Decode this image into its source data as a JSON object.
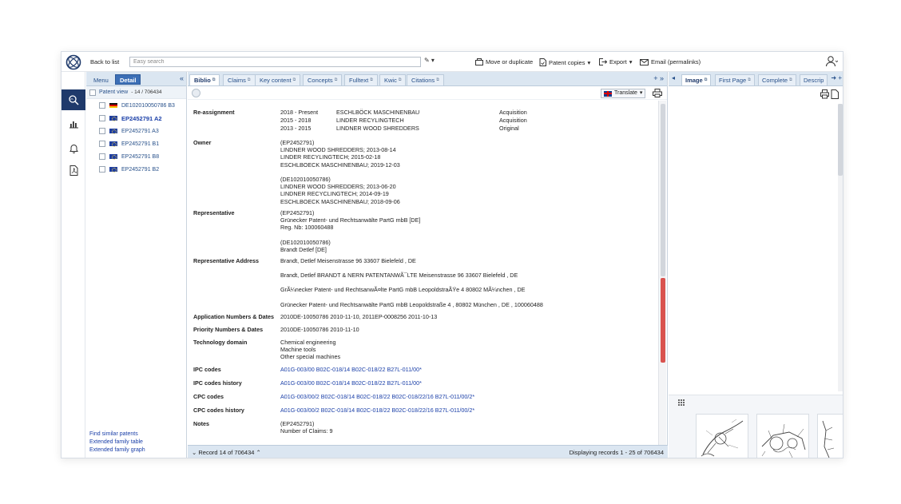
{
  "toolbar": {
    "back_label": "Back to list",
    "search_placeholder": "Easy search",
    "pen_label": "✎ ▾",
    "move_label": "Move or duplicate",
    "copies_label": "Patent copies",
    "export_label": "Export",
    "email_label": "Email (permalinks)"
  },
  "left_panel": {
    "tab_menu": "Menu",
    "tab_detail": "Detail",
    "collapse": "«",
    "tree_label": "Patent view",
    "tree_count": "- 14 / 706434",
    "items": [
      {
        "label": "DE102010050786 B3",
        "flag": "de"
      },
      {
        "label": "EP2452791 A2",
        "flag": "eu",
        "selected": true
      },
      {
        "label": "EP2452791 A3",
        "flag": "eu"
      },
      {
        "label": "EP2452791 B1",
        "flag": "eu"
      },
      {
        "label": "EP2452791 B8",
        "flag": "eu"
      },
      {
        "label": "EP2452791 B2",
        "flag": "eu"
      }
    ],
    "links": [
      "Find similar patents",
      "Extended family table",
      "Extended family graph"
    ]
  },
  "center": {
    "tabs": [
      "Biblio",
      "Claims",
      "Key content",
      "Concepts",
      "Fulltext",
      "Kwic",
      "Citations"
    ],
    "tabs_right": "+ »",
    "translate_label": "Translate",
    "reassignment_label": "Re-assignment",
    "reassignments": [
      {
        "period": "2018 - Present",
        "name": "ESCHLBÖCK MASCHINENBAU",
        "type": "Acquisition"
      },
      {
        "period": "2015 - 2018",
        "name": "LINDER RECYLINGTECH",
        "type": "Acquisition"
      },
      {
        "period": "2013 - 2015",
        "name": "LINDNER WOOD SHREDDERS",
        "type": "Original"
      }
    ],
    "owner_label": "Owner",
    "owner_lines": [
      "(EP2452791)",
      "LINDNER WOOD SHREDDERS; 2013-08-14",
      "LINDER RECYLINGTECH; 2015-02-18",
      "ESCHLBOECK MASCHINENBAU; 2019-12-03",
      "",
      "(DE102010050786)",
      "LINDNER WOOD SHREDDERS; 2013-06-20",
      "LINDNER RECYCLINGTECH; 2014-09-19",
      "ESCHLBOECK MASCHINENBAU; 2018-09-06"
    ],
    "representative_label": "Representative",
    "representative_lines": [
      "(EP2452791)",
      "Grünecker Patent- und Rechtsanwälte PartG mbB [DE]",
      "Reg. Nb: 100060488",
      "",
      "(DE102010050786)",
      "Brandt Detlef [DE]"
    ],
    "rep_address_label": "Representative Address",
    "rep_address_lines": [
      "Brandt, Detlef Meisenstrasse 96 33607 Bielefeld , DE",
      "Brandt, Detlef BRANDT & NERN PATENTANWÃ¯LTE Meisenstrasse 96 33607 Bielefeld , DE",
      "GrÃ¼necker Patent- und RechtsanwÃ¤lte PartG mbB LeopoldstraÃŸe 4 80802 MÃ¼nchen , DE",
      "Grünecker Patent- und Rechtsanwälte PartG mbB Leopoldstraße 4 , 80802 München , DE , 100060488"
    ],
    "app_numbers_label": "Application Numbers & Dates",
    "app_numbers_value": "2010DE-10050786 2010-11-10, 2011EP-0008256 2011-10-13",
    "priority_label": "Priority Numbers & Dates",
    "priority_value": "2010DE-10050786 2010-11-10",
    "tech_label": "Technology domain",
    "tech_lines": [
      "Chemical engineering",
      "Machine tools",
      "Other special machines"
    ],
    "ipc_label": "IPC codes",
    "ipc_value": "A01G-003/00 B02C-018/14 B02C-018/22 B27L-011/00*",
    "ipc_hist_label": "IPC codes history",
    "ipc_hist_value": "A01G-003/00 B02C-018/14 B02C-018/22 B27L-011/00*",
    "cpc_label": "CPC codes",
    "cpc_value": "A01G-003/00/2 B02C-018/14 B02C-018/22 B02C-018/22/16 B27L-011/00/2*",
    "cpc_hist_label": "CPC codes history",
    "cpc_hist_value": "A01G-003/00/2 B02C-018/14 B02C-018/22 B02C-018/22/16 B27L-011/00/2*",
    "notes_label": "Notes",
    "notes_lines": [
      "(EP2452791)",
      "Number of Claims: 9"
    ],
    "record_label": "Record 14 of 706434",
    "displaying_label": "Displaying records 1 - 25 of 706434"
  },
  "right": {
    "tabs": [
      "Image",
      "First Page",
      "Complete",
      "Descrip"
    ],
    "tabs_nav": "◂",
    "tabs_right": "➜ +"
  },
  "colors": {
    "accent": "#1f3a6b",
    "tab_bg": "#dbe6f1",
    "link": "#1a3fa8",
    "scroll_marker": "#d9534f"
  },
  "icons": [
    "logo-icon",
    "pen-icon",
    "move-icon",
    "copies-icon",
    "export-icon",
    "email-icon",
    "user-icon",
    "search-rail-icon",
    "chart-rail-icon",
    "bell-rail-icon",
    "pdf-rail-icon",
    "globe-icon",
    "print-icon",
    "grid-icon"
  ]
}
